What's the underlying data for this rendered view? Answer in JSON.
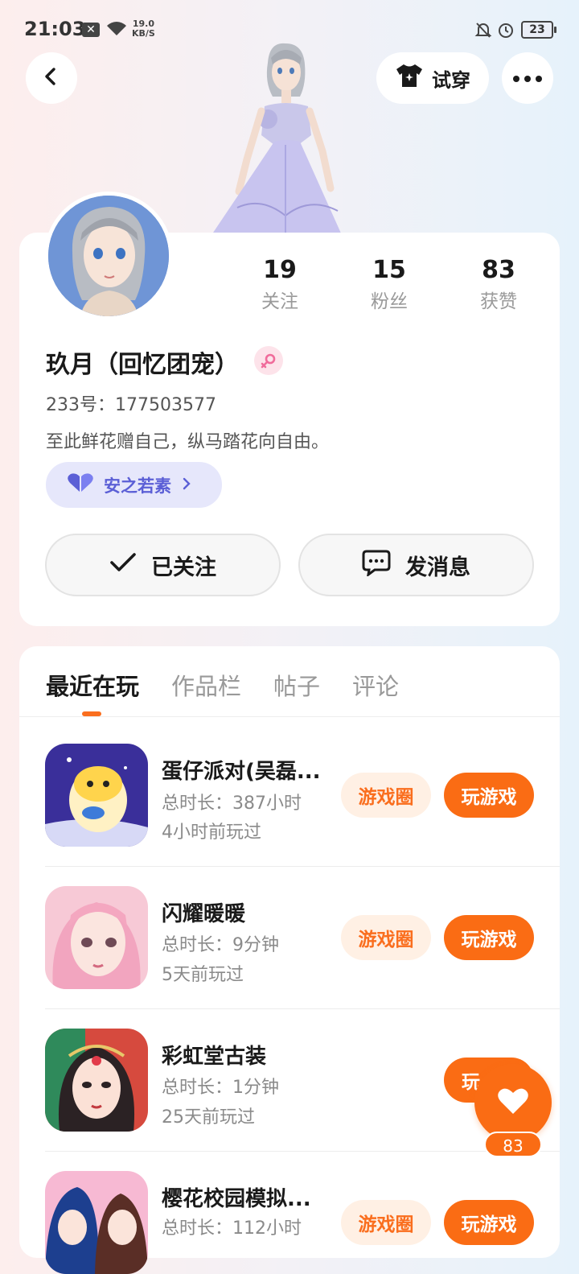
{
  "status_bar": {
    "time": "21:03",
    "net_speed_value": "19.0",
    "net_speed_unit": "KB/S",
    "battery": "23"
  },
  "header": {
    "try_on_label": "试穿"
  },
  "profile": {
    "stats": [
      {
        "value": "19",
        "label": "关注"
      },
      {
        "value": "15",
        "label": "粉丝"
      },
      {
        "value": "83",
        "label": "获赞"
      }
    ],
    "name": "玖月（回忆团宠）",
    "uid": "233号：177503577",
    "bio": "至此鲜花赠自己，纵马踏花向自由。",
    "tag": "安之若素",
    "follow_label": "已关注",
    "message_label": "发消息"
  },
  "tabs": [
    "最近在玩",
    "作品栏",
    "帖子",
    "评论"
  ],
  "games": [
    {
      "title": "蛋仔派对(吴磊...",
      "duration": "总时长：387小时",
      "last": "4小时前玩过"
    },
    {
      "title": "闪耀暖暖",
      "duration": "总时长：9分钟",
      "last": "5天前玩过"
    },
    {
      "title": "彩虹堂古装",
      "duration": "总时长：1分钟",
      "last": "25天前玩过"
    },
    {
      "title": "樱花校园模拟...",
      "duration": "总时长：112小时",
      "last": ""
    }
  ],
  "game_buttons": {
    "circle": "游戏圈",
    "play": "玩游戏",
    "play_partial": "玩"
  },
  "fab": {
    "count": "83"
  },
  "colors": {
    "accent": "#fa6c14",
    "tag_purple": "#5b5fd6"
  }
}
